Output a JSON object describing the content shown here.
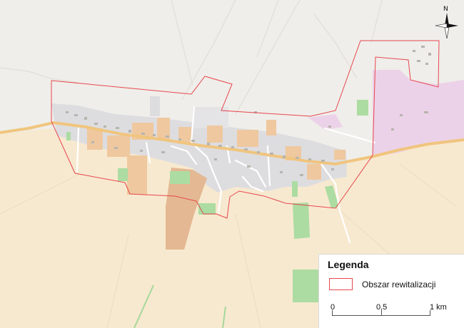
{
  "legend": {
    "title": "Legenda",
    "items": [
      {
        "label": "Obszar rewitalizacji",
        "color": "#e8474e"
      }
    ]
  },
  "scale_bar": {
    "labels": [
      "0",
      "0,5",
      "1 km"
    ]
  },
  "compass": {
    "north_label": "N",
    "icon": "north-arrow-icon"
  },
  "colors": {
    "farmland": "#f7e9cf",
    "meadow": "#efeeea",
    "residential": "#dddde0",
    "farmyard": "#efc89f",
    "orchard": "#e3b892",
    "grass": "#acdca2",
    "industrial": "#ecd2e8",
    "road": "#f0c57e",
    "boundary": "#e8474e"
  }
}
